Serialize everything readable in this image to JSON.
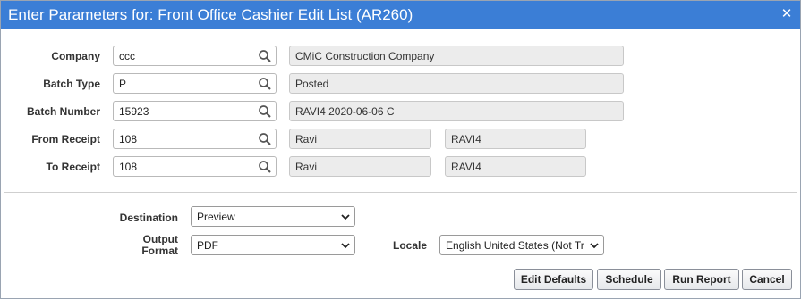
{
  "window": {
    "title": "Enter Parameters for: Front Office Cashier Edit List (AR260)",
    "close_glyph": "✕"
  },
  "params": {
    "company": {
      "label": "Company",
      "value": "ccc",
      "description": "CMiC Construction Company"
    },
    "batch_type": {
      "label": "Batch Type",
      "value": "P",
      "description": "Posted"
    },
    "batch_number": {
      "label": "Batch Number",
      "value": "15923",
      "description": "RAVI4 2020-06-06 C"
    },
    "from_receipt": {
      "label": "From Receipt",
      "value": "108",
      "description1": "Ravi",
      "description2": "RAVI4"
    },
    "to_receipt": {
      "label": "To Receipt",
      "value": "108",
      "description1": "Ravi",
      "description2": "RAVI4"
    }
  },
  "output": {
    "destination": {
      "label": "Destination",
      "value": "Preview"
    },
    "output_format": {
      "label_line1": "Output",
      "label_line2": "Format",
      "value": "PDF"
    },
    "locale": {
      "label": "Locale",
      "value": "English United States (Not Tra"
    }
  },
  "buttons": {
    "edit_defaults": "Edit Defaults",
    "schedule": "Schedule",
    "run_report": "Run Report",
    "cancel": "Cancel"
  },
  "colors": {
    "titlebar": "#3b7ed6",
    "readonly_bg": "#ececec"
  }
}
